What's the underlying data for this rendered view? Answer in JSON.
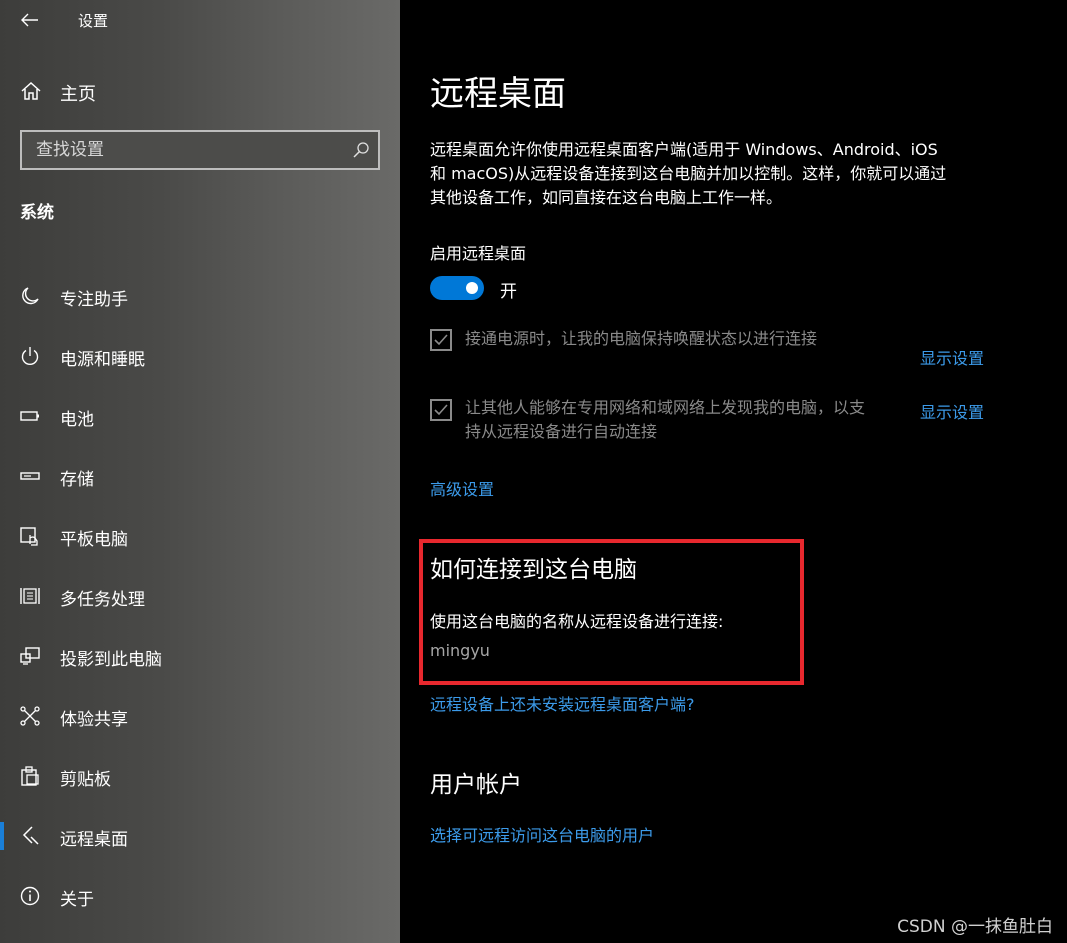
{
  "window": {
    "title": "设置"
  },
  "sidebar": {
    "home_label": "主页",
    "search": {
      "placeholder": "查找设置",
      "value": ""
    },
    "section_title": "系统",
    "items": [
      {
        "label": "专注助手",
        "icon": "moon-icon"
      },
      {
        "label": "电源和睡眠",
        "icon": "power-icon"
      },
      {
        "label": "电池",
        "icon": "battery-icon"
      },
      {
        "label": "存储",
        "icon": "storage-icon"
      },
      {
        "label": "平板电脑",
        "icon": "tablet-icon"
      },
      {
        "label": "多任务处理",
        "icon": "multitasking-icon"
      },
      {
        "label": "投影到此电脑",
        "icon": "project-icon"
      },
      {
        "label": "体验共享",
        "icon": "share-icon"
      },
      {
        "label": "剪贴板",
        "icon": "clipboard-icon"
      },
      {
        "label": "远程桌面",
        "icon": "remote-desktop-icon",
        "active": true
      },
      {
        "label": "关于",
        "icon": "info-icon"
      }
    ],
    "active_color": "#1a7fd8"
  },
  "main": {
    "page_title": "远程桌面",
    "description_lines": [
      "远程桌面允许你使用远程桌面客户端(适用于 Windows、Android、iOS",
      "和 macOS)从远程设备连接到这台电脑并加以控制。这样，你就可以通过",
      "其他设备工作，如同直接在这台电脑上工作一样。"
    ],
    "toggle": {
      "label": "启用远程桌面",
      "state_text": "开",
      "on": true,
      "color": "#0078d7"
    },
    "checkbox_1": {
      "text": "接通电源时，让我的电脑保持唤醒状态以进行连接",
      "checked": true,
      "link": "显示设置"
    },
    "checkbox_2": {
      "text_lines": [
        "让其他人能够在专用网络和域网络上发现我的电脑，以支",
        "持从远程设备进行自动连接"
      ],
      "checked": true,
      "link": "显示设置"
    },
    "advanced_link": "高级设置",
    "connect": {
      "heading": "如何连接到这台电脑",
      "description": "使用这台电脑的名称从远程设备进行连接:",
      "pc_name": "mingyu",
      "highlight_color": "#e8282e"
    },
    "no_client_link": "远程设备上还未安装远程桌面客户端?",
    "user_accounts": {
      "heading": "用户帐户",
      "link": "选择可远程访问这台电脑的用户"
    },
    "link_color": "#3c9bea"
  },
  "watermark": "CSDN @一抹鱼肚白"
}
